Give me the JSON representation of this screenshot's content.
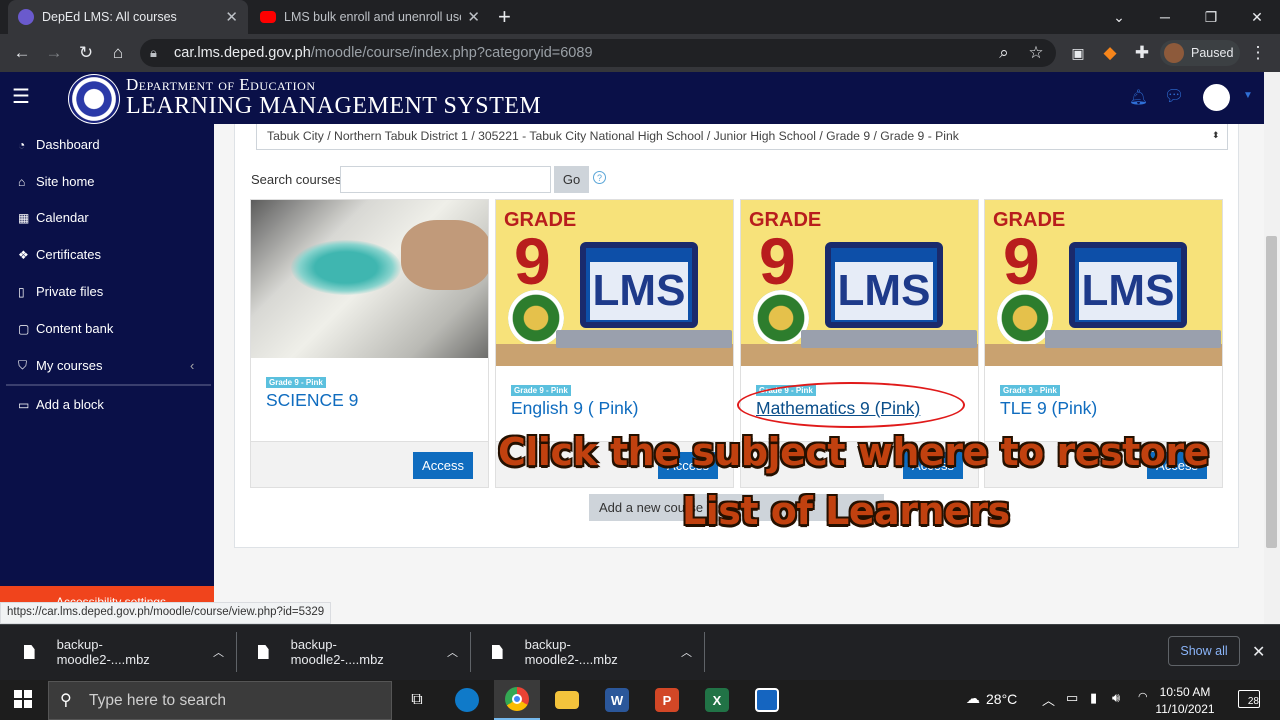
{
  "browser": {
    "tabs": [
      {
        "title": "DepEd LMS: All courses",
        "active": true
      },
      {
        "title": "LMS bulk enroll and unenroll users",
        "active": false
      }
    ],
    "new_tab": "+",
    "window_buttons": [
      "⌄",
      "─",
      "❐",
      "✕"
    ],
    "nav_icons": [
      "back-icon",
      "forward-icon",
      "reload-icon",
      "home-icon",
      "lock-icon"
    ],
    "url_host": "car.lms.deped.gov.ph",
    "url_path": "/moodle/course/index.php?categoryid=6089",
    "profile_status": "Paused"
  },
  "site": {
    "dept": "Department of Education",
    "system": "LEARNING MANAGEMENT SYSTEM"
  },
  "sidebar": {
    "items": [
      {
        "label": "Dashboard",
        "icon": "dashboard-icon"
      },
      {
        "label": "Site home",
        "icon": "home-icon"
      },
      {
        "label": "Calendar",
        "icon": "calendar-icon"
      },
      {
        "label": "Certificates",
        "icon": "certificate-icon"
      },
      {
        "label": "Private files",
        "icon": "file-icon"
      },
      {
        "label": "Content bank",
        "icon": "clipboard-icon"
      },
      {
        "label": "My courses",
        "icon": "graduation-cap-icon"
      },
      {
        "label": "Add a block",
        "icon": "plus-square-icon"
      }
    ],
    "accessibility": "Accessibility settings"
  },
  "main": {
    "category_select": "Tabuk City / Northern Tabuk District 1 / 305221 - Tabuk City National High School / Junior High School / Grade 9 / Grade 9 - Pink",
    "search_label": "Search courses",
    "search_value": "",
    "go_label": "Go",
    "help": "?",
    "courses": [
      {
        "badge": "Grade 9 - Pink",
        "name": "SCIENCE 9",
        "action": "Access"
      },
      {
        "badge": "Grade 9 - Pink",
        "name": "English 9 ( Pink)",
        "action": "Access"
      },
      {
        "badge": "Grade 9 - Pink",
        "name": "Mathematics 9 (Pink)",
        "action": "Access"
      },
      {
        "badge": "Grade 9 - Pink",
        "name": "TLE 9 (Pink)",
        "action": "Access"
      }
    ],
    "course_image_text": {
      "grade": "GRADE",
      "number": "9",
      "lms": "LMS"
    },
    "add_course": "Add a new course",
    "overlay_line1": "Click the subject where to restore",
    "overlay_line2": "List of Learners"
  },
  "status_url": "https://car.lms.deped.gov.ph/moodle/course/view.php?id=5329",
  "downloads": {
    "items": [
      "backup-moodle2-....mbz",
      "backup-moodle2-....mbz",
      "backup-moodle2-....mbz"
    ],
    "show_all": "Show all"
  },
  "taskbar": {
    "search_placeholder": "Type here to search",
    "apps": [
      "task-view-icon",
      "edge-icon",
      "chrome-icon",
      "file-explorer-icon",
      "word-icon",
      "powerpoint-icon",
      "excel-icon",
      "app-icon"
    ],
    "temperature": "28°C",
    "time": "10:50 AM",
    "date": "11/10/2021",
    "notifications": "28"
  }
}
